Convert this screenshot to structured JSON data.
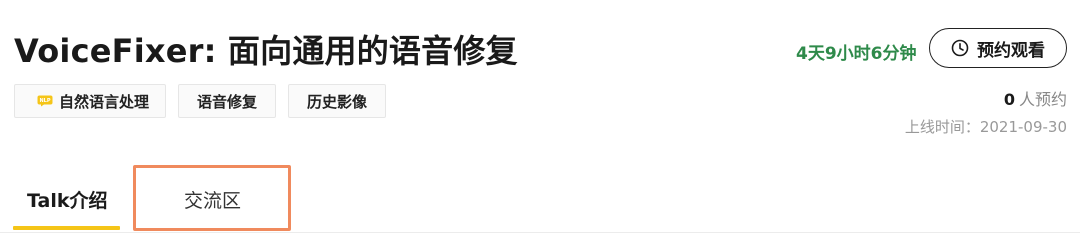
{
  "header": {
    "title": "VoiceFixer: 面向通用的语音修复"
  },
  "tags": [
    {
      "label": "自然语言处理",
      "icon": "nlp-icon"
    },
    {
      "label": "语音修复"
    },
    {
      "label": "历史影像"
    }
  ],
  "status": {
    "countdown": "4天9小时6分钟",
    "reserve_button_label": "预约观看",
    "reserve_count": "0",
    "reserve_suffix": "人预约",
    "online_time": "上线时间：2021-09-30"
  },
  "tabs": [
    {
      "label": "Talk介绍",
      "active": true
    },
    {
      "label": "交流区",
      "active": false
    }
  ],
  "colors": {
    "countdown_green": "#2e8a4a",
    "active_tab_underline": "#f5c518",
    "highlight_box": "#f08a5d"
  }
}
